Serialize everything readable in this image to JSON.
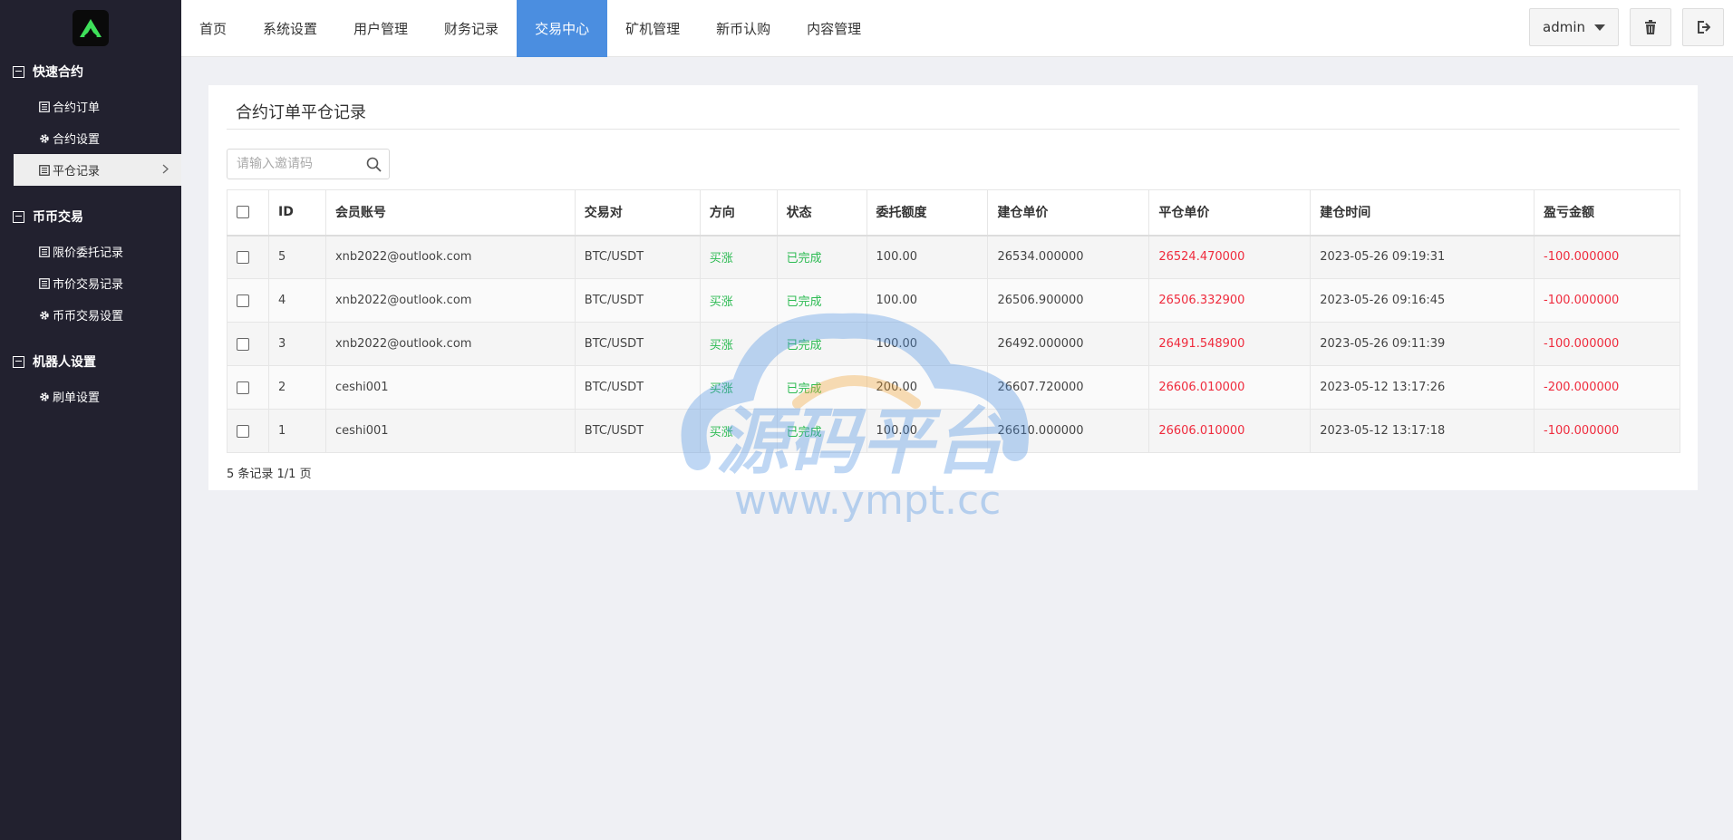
{
  "sidebar": {
    "groups": [
      {
        "title": "快速合约",
        "items": [
          {
            "label": "合约订单",
            "icon": "list-icon"
          },
          {
            "label": "合约设置",
            "icon": "gear-icon"
          },
          {
            "label": "平仓记录",
            "icon": "list-icon",
            "active": true
          }
        ]
      },
      {
        "title": "币币交易",
        "items": [
          {
            "label": "限价委托记录",
            "icon": "list-icon"
          },
          {
            "label": "市价交易记录",
            "icon": "list-icon"
          },
          {
            "label": "币币交易设置",
            "icon": "gear-icon"
          }
        ]
      },
      {
        "title": "机器人设置",
        "items": [
          {
            "label": "刷单设置",
            "icon": "gear-icon"
          }
        ]
      }
    ]
  },
  "nav": {
    "items": [
      "首页",
      "系统设置",
      "用户管理",
      "财务记录",
      "交易中心",
      "矿机管理",
      "新币认购",
      "内容管理"
    ],
    "active_index": 4,
    "admin_label": "admin"
  },
  "panel": {
    "title": "合约订单平仓记录",
    "search_placeholder": "请输入邀请码",
    "columns": [
      "ID",
      "会员账号",
      "交易对",
      "方向",
      "状态",
      "委托额度",
      "建仓单价",
      "平仓单价",
      "建仓时间",
      "盈亏金额"
    ],
    "rows": [
      {
        "id": "5",
        "account": "xnb2022@outlook.com",
        "pair": "BTC/USDT",
        "direction": "买涨",
        "status": "已完成",
        "amount": "100.00",
        "open_price": "26534.000000",
        "close_price": "26524.470000",
        "open_time": "2023-05-26 09:19:31",
        "pnl": "-100.000000"
      },
      {
        "id": "4",
        "account": "xnb2022@outlook.com",
        "pair": "BTC/USDT",
        "direction": "买涨",
        "status": "已完成",
        "amount": "100.00",
        "open_price": "26506.900000",
        "close_price": "26506.332900",
        "open_time": "2023-05-26 09:16:45",
        "pnl": "-100.000000"
      },
      {
        "id": "3",
        "account": "xnb2022@outlook.com",
        "pair": "BTC/USDT",
        "direction": "买涨",
        "status": "已完成",
        "amount": "100.00",
        "open_price": "26492.000000",
        "close_price": "26491.548900",
        "open_time": "2023-05-26 09:11:39",
        "pnl": "-100.000000"
      },
      {
        "id": "2",
        "account": "ceshi001",
        "pair": "BTC/USDT",
        "direction": "买涨",
        "status": "已完成",
        "amount": "200.00",
        "open_price": "26607.720000",
        "close_price": "26606.010000",
        "open_time": "2023-05-12 13:17:26",
        "pnl": "-200.000000"
      },
      {
        "id": "1",
        "account": "ceshi001",
        "pair": "BTC/USDT",
        "direction": "买涨",
        "status": "已完成",
        "amount": "100.00",
        "open_price": "26610.000000",
        "close_price": "26606.010000",
        "open_time": "2023-05-12 13:17:18",
        "pnl": "-100.000000"
      }
    ],
    "footer": "5 条记录 1/1 页"
  },
  "watermark": {
    "text": "源码平台",
    "url": "www.ympt.cc"
  },
  "colors": {
    "sidebar_bg": "#22212f",
    "nav_active": "#4b8ee0",
    "positive": "#2dbb53",
    "negative": "#ef2b3d"
  }
}
